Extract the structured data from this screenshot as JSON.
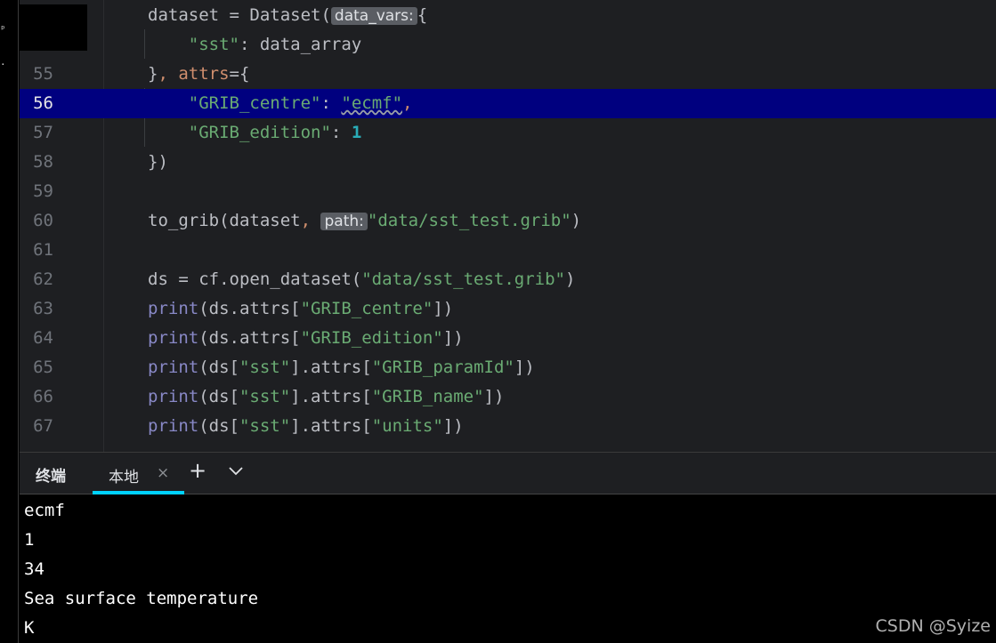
{
  "editor": {
    "lines": [
      {
        "num": "",
        "parts": [
          {
            "t": "dataset = Dataset(",
            "c": "plain"
          },
          {
            "t": "data_vars:",
            "c": "inlay"
          },
          {
            "t": "{",
            "c": "plain"
          }
        ]
      },
      {
        "num": "",
        "parts": [
          {
            "t": "    ",
            "c": "plain"
          },
          {
            "t": "\"sst\"",
            "c": "str"
          },
          {
            "t": ": data_array",
            "c": "plain"
          }
        ]
      },
      {
        "num": "55",
        "parts": [
          {
            "t": "}",
            "c": "plain"
          },
          {
            "t": ", ",
            "c": "kw"
          },
          {
            "t": "attrs",
            "c": "kw"
          },
          {
            "t": "={",
            "c": "plain"
          }
        ]
      },
      {
        "num": "56",
        "current": true,
        "parts": [
          {
            "t": "    ",
            "c": "plain"
          },
          {
            "t": "\"GRIB_centre\"",
            "c": "str"
          },
          {
            "t": ": ",
            "c": "plain"
          },
          {
            "t": "\"ecmf\"",
            "c": "str-squiggle"
          },
          {
            "t": ",",
            "c": "kw"
          }
        ]
      },
      {
        "num": "57",
        "parts": [
          {
            "t": "    ",
            "c": "plain"
          },
          {
            "t": "\"GRIB_edition\"",
            "c": "str"
          },
          {
            "t": ": ",
            "c": "plain"
          },
          {
            "t": "1",
            "c": "num"
          }
        ]
      },
      {
        "num": "58",
        "parts": [
          {
            "t": "})",
            "c": "plain"
          }
        ]
      },
      {
        "num": "59",
        "parts": []
      },
      {
        "num": "60",
        "parts": [
          {
            "t": "to_grib(dataset",
            "c": "plain"
          },
          {
            "t": ", ",
            "c": "kw"
          },
          {
            "t": "path:",
            "c": "inlay"
          },
          {
            "t": "\"data/sst_test.grib\"",
            "c": "str"
          },
          {
            "t": ")",
            "c": "plain"
          }
        ]
      },
      {
        "num": "61",
        "parts": []
      },
      {
        "num": "62",
        "parts": [
          {
            "t": "ds = cf.open_dataset(",
            "c": "plain"
          },
          {
            "t": "\"data/sst_test.grib\"",
            "c": "str"
          },
          {
            "t": ")",
            "c": "plain"
          }
        ]
      },
      {
        "num": "63",
        "parts": [
          {
            "t": "print",
            "c": "fn"
          },
          {
            "t": "(ds.attrs[",
            "c": "plain"
          },
          {
            "t": "\"GRIB_centre\"",
            "c": "str"
          },
          {
            "t": "])",
            "c": "plain"
          }
        ]
      },
      {
        "num": "64",
        "parts": [
          {
            "t": "print",
            "c": "fn"
          },
          {
            "t": "(ds.attrs[",
            "c": "plain"
          },
          {
            "t": "\"GRIB_edition\"",
            "c": "str"
          },
          {
            "t": "])",
            "c": "plain"
          }
        ]
      },
      {
        "num": "65",
        "parts": [
          {
            "t": "print",
            "c": "fn"
          },
          {
            "t": "(ds[",
            "c": "plain"
          },
          {
            "t": "\"sst\"",
            "c": "str"
          },
          {
            "t": "].attrs[",
            "c": "plain"
          },
          {
            "t": "\"GRIB_paramId\"",
            "c": "str"
          },
          {
            "t": "])",
            "c": "plain"
          }
        ]
      },
      {
        "num": "66",
        "parts": [
          {
            "t": "print",
            "c": "fn"
          },
          {
            "t": "(ds[",
            "c": "plain"
          },
          {
            "t": "\"sst\"",
            "c": "str"
          },
          {
            "t": "].attrs[",
            "c": "plain"
          },
          {
            "t": "\"GRIB_name\"",
            "c": "str"
          },
          {
            "t": "])",
            "c": "plain"
          }
        ]
      },
      {
        "num": "67",
        "parts": [
          {
            "t": "print",
            "c": "fn"
          },
          {
            "t": "(ds[",
            "c": "plain"
          },
          {
            "t": "\"sst\"",
            "c": "str"
          },
          {
            "t": "].attrs[",
            "c": "plain"
          },
          {
            "t": "\"units\"",
            "c": "str"
          },
          {
            "t": "])",
            "c": "plain"
          }
        ]
      }
    ]
  },
  "panel": {
    "title": "终端",
    "tab_label": "本地",
    "tab_close": "×",
    "new_tab": "+",
    "dropdown": "chevron-down"
  },
  "terminal": {
    "output": [
      "ecmf",
      "1",
      "34",
      "Sea surface temperature",
      "K"
    ]
  },
  "watermark": "CSDN @Syize",
  "colors": {
    "current_line": "#00007f",
    "tab_underline": "#00d2ff",
    "string": "#6aab73",
    "keyword": "#cf8e6d",
    "builtin": "#8888c6",
    "number": "#2aacb8"
  }
}
